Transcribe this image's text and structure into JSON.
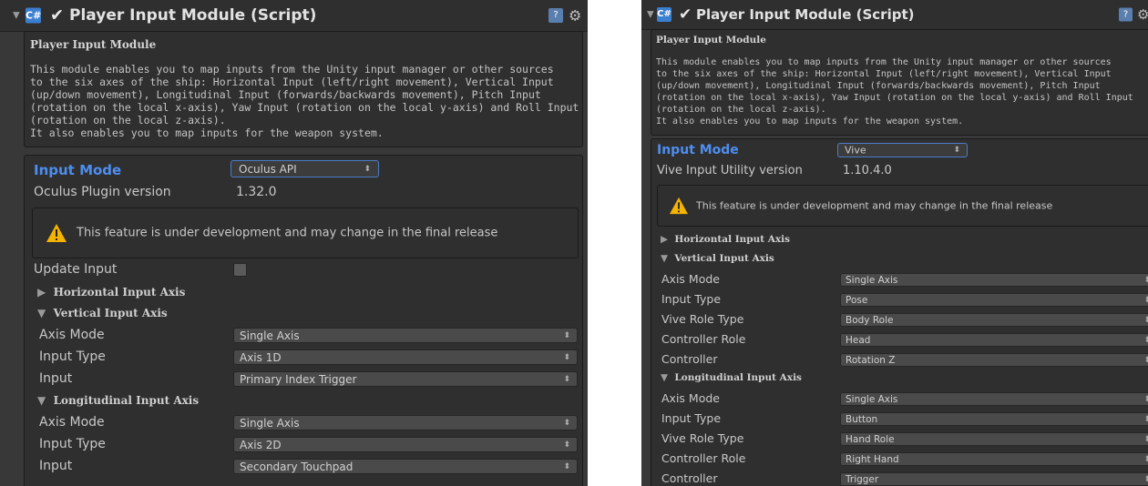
{
  "panels": [
    {
      "component_title": "Player Input Module (Script)",
      "description_title": "Player Input Module",
      "description_lines": [
        "This module enables you to map inputs from the Unity input manager or other sources",
        "to the six axes of the ship: Horizontal Input (left/right movement), Vertical Input",
        "(up/down movement), Longitudinal Input (forwards/backwards movement), Pitch Input",
        "(rotation on the local x-axis), Yaw Input (rotation on the local y-axis) and Roll Input",
        "(rotation on the local z-axis).",
        "It also enables you to map inputs for the weapon system."
      ],
      "input_mode_label": "Input Mode",
      "input_mode_value": "Oculus API",
      "version_label": "Oculus Plugin version",
      "version_value": "1.32.0",
      "warning_text": "This feature is under development and may change in the final release",
      "update_input_label": "Update Input",
      "horizontal_label": "Horizontal Input Axis",
      "vertical_label": "Vertical Input Axis",
      "vertical_rows": [
        {
          "label": "Axis Mode",
          "value": "Single Axis"
        },
        {
          "label": "Input Type",
          "value": "Axis 1D"
        },
        {
          "label": "Input",
          "value": "Primary Index Trigger"
        }
      ],
      "longitudinal_label": "Longitudinal Input Axis",
      "longitudinal_rows": [
        {
          "label": "Axis Mode",
          "value": "Single Axis"
        },
        {
          "label": "Input Type",
          "value": "Axis 2D"
        },
        {
          "label": "Input",
          "value": "Secondary Touchpad"
        }
      ]
    },
    {
      "component_title": "Player Input Module (Script)",
      "description_title": "Player Input Module",
      "description_lines": [
        "This module enables you to map inputs from the Unity input manager or other sources",
        "to the six axes of the ship: Horizontal Input (left/right movement), Vertical Input",
        "(up/down movement), Longitudinal Input (forwards/backwards movement), Pitch Input",
        "(rotation on the local x-axis), Yaw Input (rotation on the local y-axis) and Roll Input",
        "(rotation on the local z-axis).",
        "It also enables you to map inputs for the weapon system."
      ],
      "input_mode_label": "Input Mode",
      "input_mode_value": "Vive",
      "version_label": "Vive Input Utility version",
      "version_value": "1.10.4.0",
      "warning_text": "This feature is under development and may change in the final release",
      "horizontal_label": "Horizontal Input Axis",
      "vertical_label": "Vertical Input Axis",
      "vertical_rows": [
        {
          "label": "Axis Mode",
          "value": "Single Axis"
        },
        {
          "label": "Input Type",
          "value": "Pose"
        },
        {
          "label": "Vive Role Type",
          "value": "Body Role"
        },
        {
          "label": "Controller Role",
          "value": "Head"
        },
        {
          "label": "Controller",
          "value": "Rotation Z"
        }
      ],
      "longitudinal_label": "Longitudinal Input Axis",
      "longitudinal_rows": [
        {
          "label": "Axis Mode",
          "value": "Single Axis"
        },
        {
          "label": "Input Type",
          "value": "Button"
        },
        {
          "label": "Vive Role Type",
          "value": "Hand Role"
        },
        {
          "label": "Controller Role",
          "value": "Right Hand"
        },
        {
          "label": "Controller",
          "value": "Trigger"
        }
      ]
    }
  ],
  "icons": {
    "foldout_collapsed": "triangle-right-icon",
    "foldout_expanded": "triangle-down-icon",
    "script": "csharp-script-icon",
    "help": "book-help-icon",
    "settings": "gear-icon",
    "warning": "warning-icon",
    "dropdown": "up-down-arrows-icon"
  },
  "colors": {
    "panel_bg": "#383838",
    "box_bg": "#2f2f2f",
    "highlight_label": "#4d8ef0",
    "warning": "#f3b300"
  }
}
